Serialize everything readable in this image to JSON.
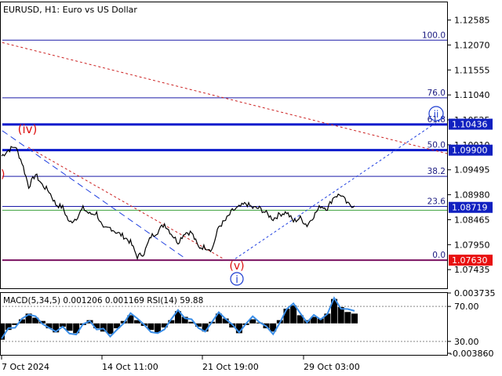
{
  "header": {
    "symbol_title": "EURUSD, H1:  Euro vs US Dollar",
    "indicator_title": "MACD(5,34,5) 0.001206 0.001169 RSI(14) 59.88"
  },
  "colors": {
    "background": "#ffffff",
    "price_line": "#000000",
    "fib_level": "#1a1aa8",
    "key_level": "#0a1acc",
    "support_level": "#7a1060",
    "green_level": "#3aa03a",
    "trend_red_dashed": "#cc2020",
    "channel_blue_dashed": "#2040e0",
    "wave_label_red": "#dd1010",
    "wave_label_blue": "#1a3ad0",
    "macd_line": "#3a8ee8",
    "badge_blue": "#1020c0",
    "badge_red": "#e81010",
    "grid_dot": "#888888"
  },
  "chart_data": [
    {
      "type": "line",
      "title": "EURUSD, H1:  Euro vs US Dollar",
      "ylim": [
        1.0705,
        1.1295
      ],
      "y_ticks": [
        "1.12585",
        "1.12070",
        "1.11555",
        "1.11040",
        "1.10525",
        "1.10010",
        "1.09495",
        "1.08980",
        "1.08465",
        "1.07950",
        "1.07435"
      ],
      "x_ticks": [
        "7 Oct 2024",
        "14 Oct 11:00",
        "21 Oct 19:00",
        "29 Oct 03:00"
      ],
      "series": [
        {
          "x": [
            0,
            3,
            6,
            9,
            12,
            15,
            18,
            21,
            24,
            27,
            30,
            33,
            36,
            39,
            42,
            45,
            48,
            51,
            54,
            57,
            60,
            63,
            66,
            69,
            72,
            75,
            78,
            81,
            84,
            87,
            90,
            93,
            96,
            99,
            102,
            105,
            108,
            111,
            114,
            117,
            120,
            123,
            126,
            129,
            132,
            135,
            138,
            141,
            144,
            147,
            150,
            153,
            156
          ],
          "values": [
            1.0978,
            1.099,
            1.0998,
            1.0965,
            1.0915,
            1.094,
            1.0918,
            1.0905,
            1.0878,
            1.0872,
            1.084,
            1.085,
            1.087,
            1.0858,
            1.086,
            1.0826,
            1.083,
            1.082,
            1.0812,
            1.08,
            1.077,
            1.0778,
            1.0812,
            1.0822,
            1.0838,
            1.0818,
            1.08,
            1.082,
            1.082,
            1.079,
            1.079,
            1.0785,
            1.0832,
            1.0845,
            1.0865,
            1.0872,
            1.088,
            1.0871,
            1.087,
            1.086,
            1.0848,
            1.0858,
            1.0862,
            1.0843,
            1.085,
            1.0835,
            1.0855,
            1.0875,
            1.087,
            1.0895,
            1.0898,
            1.0878,
            1.0875
          ]
        }
      ],
      "levels": [
        {
          "label": "100.0",
          "value": 1.1217
        },
        {
          "label": "76.0",
          "value": 1.1098
        },
        {
          "label": "61.8",
          "value": 1.1043
        },
        {
          "label": "50.0",
          "value": 1.099
        },
        {
          "label": "38.2",
          "value": 1.0936
        },
        {
          "label": "23.6",
          "value": 1.0874
        },
        {
          "label": "0.0",
          "value": 1.0763
        }
      ],
      "price_badges": [
        {
          "label": "1.10436",
          "value": 1.10436,
          "color": "#1020c0"
        },
        {
          "label": "1.09900",
          "value": 1.099,
          "color": "#1020c0"
        },
        {
          "label": "1.08719",
          "value": 1.08719,
          "color": "#1020c0"
        },
        {
          "label": "1.07630",
          "value": 1.0763,
          "color": "#e81010"
        }
      ],
      "wave_labels": [
        {
          "text": "(iv)",
          "color": "#dd1010"
        },
        {
          "text": "(v)",
          "color": "#dd1010"
        },
        {
          "text": "i",
          "color": "#1a3ad0"
        },
        {
          "text": "ii",
          "color": "#1a3ad0"
        },
        {
          "text": ")",
          "color": "#dd1010"
        }
      ]
    },
    {
      "type": "line",
      "title": "MACD(5,34,5) 0.001206 0.001169 RSI(14) 59.88",
      "ylim": [
        -0.00386,
        0.003735
      ],
      "y_ticks": [
        "0.003735",
        "70.00",
        "30.00",
        "-0.003860"
      ],
      "rsi_levels": [
        70,
        30
      ],
      "series": [
        {
          "name": "MACD",
          "values": [
            -0.002,
            -0.0008,
            -0.0002,
            0.0005,
            0.0012,
            0.0007,
            0.0003,
            -0.0006,
            -0.0011,
            -0.0004,
            -0.0009,
            -0.0012,
            -0.0002,
            0.0004,
            -0.0006,
            -0.001,
            -0.0013,
            -0.0006,
            0.0003,
            0.001,
            0.0004,
            -0.0003,
            -0.0008,
            -0.0011,
            -0.0005,
            0.0004,
            0.0015,
            0.0008,
            0.0002,
            -0.0004,
            -0.001,
            0.0002,
            0.0012,
            0.0006,
            -0.0005,
            -0.0012,
            -0.0002,
            0.0005,
            0.0001,
            -0.0006,
            -0.001,
            0.0004,
            0.0018,
            0.0022,
            0.001,
            0.0004,
            0.0008,
            0.0006,
            0.0012,
            0.003,
            0.002,
            0.0014,
            0.0012
          ]
        }
      ]
    }
  ]
}
